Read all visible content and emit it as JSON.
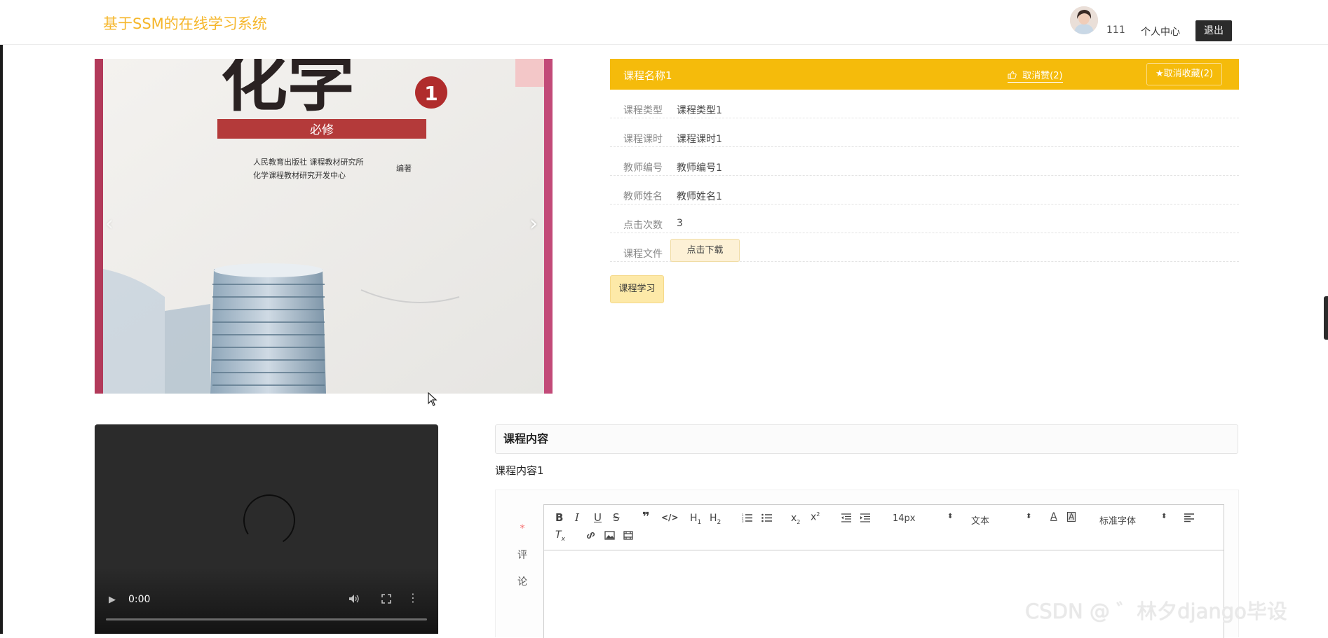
{
  "header": {
    "logo": "基于SSM的在线学习系统",
    "username": "111",
    "profile_link": "个人中心",
    "logout": "退出"
  },
  "carousel": {
    "cover_title": "化学",
    "cover_number": "1",
    "cover_subtitle": "必修",
    "publisher_line1": "人民教育出版社  课程教材研究所",
    "publisher_line2": "化学课程教材研究开发中心",
    "publisher_suffix": "编著"
  },
  "course": {
    "title": "课程名称1",
    "unlike": "取消赞(2)",
    "unfavorite": "★取消收藏(2)",
    "rows": [
      {
        "label": "课程类型",
        "value": "课程类型1"
      },
      {
        "label": "课程课时",
        "value": "课程课时1"
      },
      {
        "label": "教师编号",
        "value": "教师编号1"
      },
      {
        "label": "教师姓名",
        "value": "教师姓名1"
      },
      {
        "label": "点击次数",
        "value": "3"
      }
    ],
    "file_label": "课程文件",
    "file_button": "点击下载",
    "study_button": "课程学习"
  },
  "video": {
    "time": "0:00"
  },
  "content": {
    "heading": "课程内容",
    "body": "课程内容1"
  },
  "comment": {
    "required_mark": "*",
    "label_line1": "评",
    "label_line2": "论"
  },
  "editor": {
    "font_size": "14px",
    "paragraph": "文本",
    "font_family": "标准字体"
  },
  "watermark": "CSDN @ ゛林夕django毕设",
  "colors": {
    "brand": "#f5b62a",
    "header_bar": "#f5bb0b",
    "logout_bg": "#2b2b2b"
  }
}
